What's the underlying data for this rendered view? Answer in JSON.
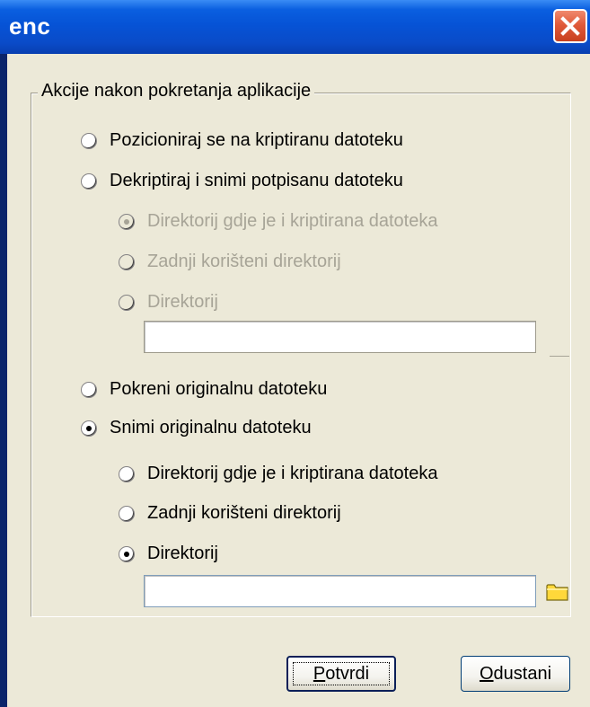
{
  "window": {
    "title": "enc"
  },
  "group": {
    "legend": "Akcije nakon pokretanja aplikacije"
  },
  "options": {
    "position": "Pozicioniraj se na kriptiranu datoteku",
    "decrypt": "Dekriptiraj i snimi potpisanu datoteku",
    "run": "Pokreni originalnu datoteku",
    "save": "Snimi originalnu datoteku"
  },
  "decrypt_sub": {
    "same_dir": "Direktorij gdje je i kriptirana datoteka",
    "last_dir": "Zadnji korišteni direktorij",
    "dir": "Direktorij",
    "path_value": ""
  },
  "save_sub": {
    "same_dir": "Direktorij gdje je i kriptirana datoteka",
    "last_dir": "Zadnji korišteni direktorij",
    "dir": "Direktorij",
    "path_value": ""
  },
  "selected": {
    "main": "save",
    "decrypt_sub": "same_dir",
    "save_sub": "dir"
  },
  "buttons": {
    "ok_mnemonic": "P",
    "ok_rest": "otvrdi",
    "cancel_mnemonic": "O",
    "cancel_rest": "dustani"
  },
  "colors": {
    "title_bar": "#0653d6",
    "dialog_bg": "#ece9d8",
    "disabled_text": "#a7a497",
    "close_button": "#e05a3a"
  },
  "icons": {
    "close": "close-x-icon",
    "folder": "folder-icon"
  }
}
